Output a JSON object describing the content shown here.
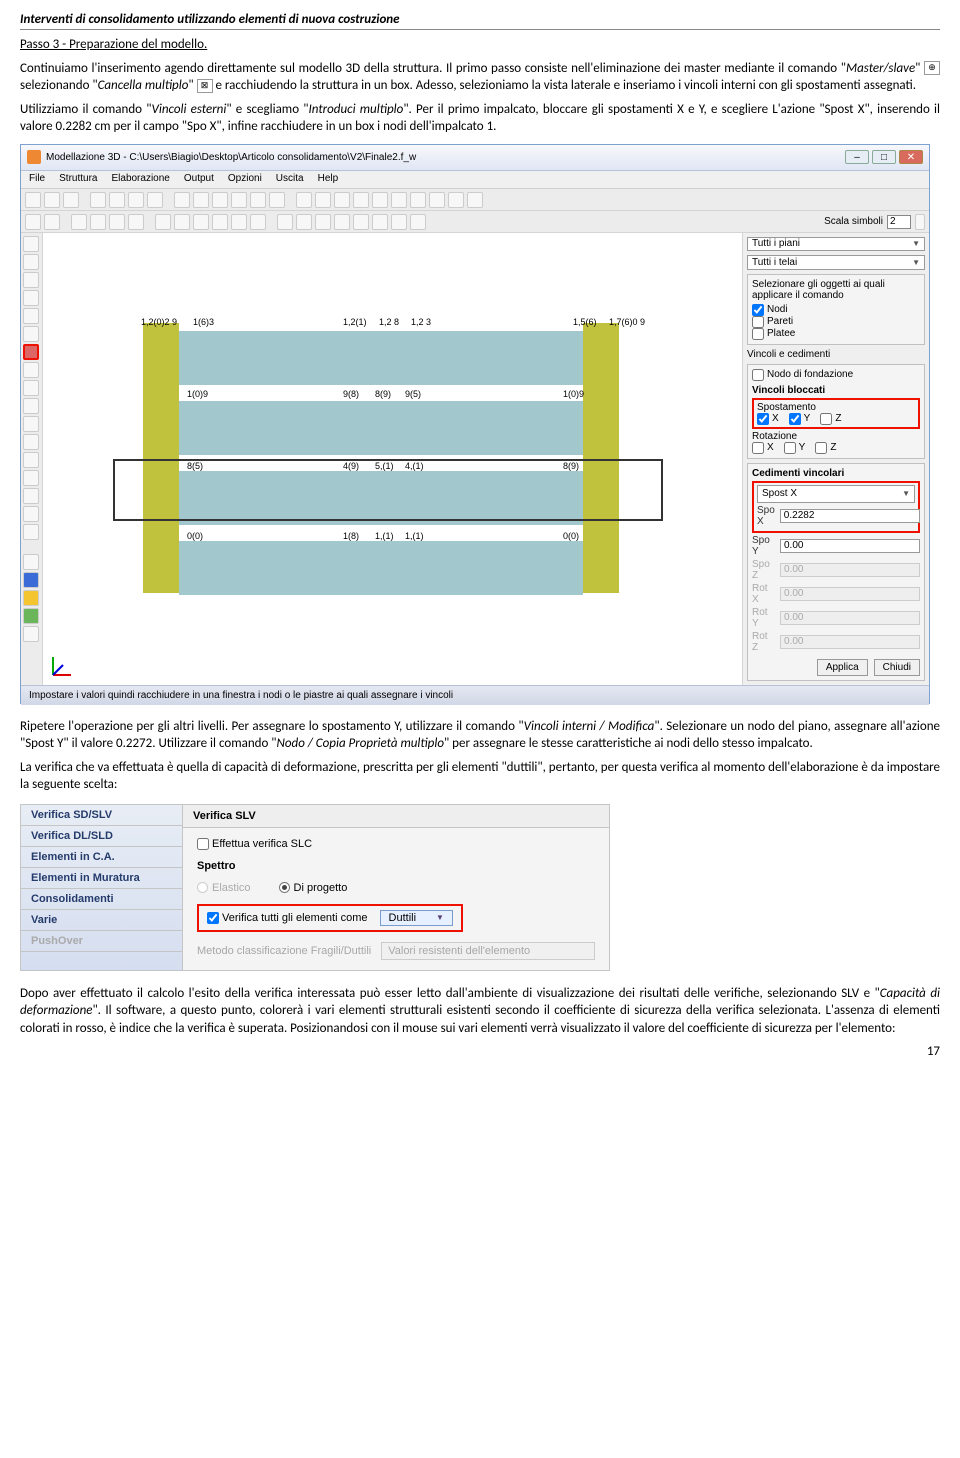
{
  "header": {
    "title": "Interventi di consolidamento utilizzando elementi di nuova costruzione"
  },
  "p1": {
    "step": "Passo 3 - Preparazione del modello.",
    "line1a": "Continuiamo l'inserimento agendo direttamente sul modello 3D della struttura. Il primo passo consiste nell'eliminazione dei master mediante il comando \"",
    "cmd1": "Master/slave",
    "line1b": "\" ",
    "line1c": " selezionando \"",
    "cmd2": "Cancella multiplo",
    "line1d": "\" ",
    "line1e": " e racchiudendo la struttura in un box. Adesso, selezioniamo la vista laterale e inseriamo i vincoli interni con gli spostamenti assegnati."
  },
  "p2": {
    "a": "Utilizziamo il comando \"",
    "cmd": "Vincoli esterni",
    "b": "\" e scegliamo \"",
    "cmd2": "Introduci multiplo",
    "c": "\". Per il primo impalcato, bloccare gli spostamenti X e Y, e scegliere L'azione \"Spost X\", inserendo il valore 0.2282 cm per il campo \"Spo X\", infine racchiudere in un box i nodi dell'impalcato 1."
  },
  "app": {
    "title": "Modellazione 3D - C:\\Users\\Biagio\\Desktop\\Articolo consolidamento\\V2\\Finale2.f_w",
    "menus": [
      "File",
      "Struttura",
      "Elaborazione",
      "Output",
      "Opzioni",
      "Uscita",
      "Help"
    ],
    "scala_label": "Scala simboli",
    "scala_value": "2",
    "statusbar": "Impostare i valori quindi racchiudere in una finestra i nodi o le piastre ai quali assegnare i vincoli",
    "labels_top": [
      "1,2(0)2 9",
      "1(6)3",
      "1,2(1)",
      "1,2 8",
      "1,2 3",
      "1,5(6)",
      "1,7(6)0 9"
    ],
    "labels_r2": [
      "1(0)9",
      "9(8)",
      "8(9)",
      "9(5)",
      "1(0)9"
    ],
    "labels_r3": [
      "8(5)",
      "4(9)",
      "5,(1)",
      "4,(1)",
      "8(9)"
    ],
    "labels_r4": [
      "0(0)",
      "1(8)",
      "1,(1)",
      "1,(1)",
      "0(0)"
    ]
  },
  "panel": {
    "combo1": "Tutti i piani",
    "combo2": "Tutti i telai",
    "seltxt": "Selezionare gli oggetti ai quali applicare il comando",
    "nodi": "Nodi",
    "pareti": "Pareti",
    "platee": "Platee",
    "vinc_ced": "Vincoli e cedimenti",
    "fondazione": "Nodo di fondazione",
    "vbloc": "Vincoli bloccati",
    "spost": "Spostamento",
    "rot": "Rotazione",
    "x": "X",
    "y": "Y",
    "z": "Z",
    "ced": "Cedimenti vincolari",
    "combo3": "Spost X",
    "spox": "Spo X",
    "spox_v": "0.2282",
    "spoy": "Spo Y",
    "spoy_v": "0.00",
    "spoz": "Spo Z",
    "spoz_v": "0.00",
    "rotx": "Rot X",
    "rotx_v": "0.00",
    "roty": "Rot Y",
    "roty_v": "0.00",
    "rotz": "Rot Z",
    "rotz_v": "0.00",
    "applica": "Applica",
    "chiudi": "Chiudi"
  },
  "p3": {
    "a": "Ripetere l'operazione per gli altri livelli. Per assegnare lo spostamento Y, utilizzare il comando \"",
    "cmd1": "Vincoli interni / Modifica",
    "b": "\". Selezionare un nodo del piano, assegnare all'azione \"Spost Y\" il valore 0.2272. Utilizzare il comando \"",
    "cmd2": "Nodo / Copia Proprietà multiplo",
    "c": "\" per assegnare le stesse caratteristiche ai nodi dello stesso impalcato."
  },
  "p4": "La verifica che va effettuata è quella di capacità di deformazione, prescritta per gli elementi \"duttili\", pertanto, per questa verifica al momento dell'elaborazione è da impostare la seguente scelta:",
  "s2": {
    "left": [
      "Verifica SD/SLV",
      "Verifica DL/SLD",
      "Elementi in C.A.",
      "Elementi in Muratura",
      "Consolidamenti",
      "Varie",
      "PushOver"
    ],
    "tab": "Verifica SLV",
    "slc": "Effettua verifica SLC",
    "spettro": "Spettro",
    "elastico": "Elastico",
    "diprog": "Di progetto",
    "verchk": "Verifica tutti gli elementi come",
    "duttili": "Duttili",
    "metodo": "Metodo classificazione Fragili/Duttili",
    "metodo_v": "Valori resistenti dell'elemento"
  },
  "p5": {
    "a": "Dopo aver effettuato il calcolo l'esito della verifica interessata può esser letto dall'ambiente di visualizzazione dei risultati delle verifiche, selezionando SLV e \"",
    "cmd": "Capacità di deformazione",
    "b": "\". Il software, a questo punto, colorerà i vari elementi strutturali esistenti secondo il coefficiente di sicurezza della verifica selezionata. L'assenza di elementi colorati in rosso, è indice che la verifica è superata. Posizionandosi con il mouse sui vari elementi verrà visualizzato il valore del coefficiente di sicurezza per l'elemento:"
  },
  "pagenum": "17"
}
